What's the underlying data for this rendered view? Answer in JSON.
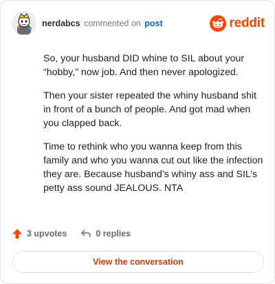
{
  "header": {
    "username": "nerdabcs",
    "action_text": "commented on",
    "post_link": "post",
    "brand_name": "reddit",
    "brand_color": "#ff4500",
    "avatar_icon": "snoo-avatar-icon"
  },
  "comment": {
    "paragraphs": [
      "So, your husband DID whine to SIL about your “hobby,” now job. And then never apologized.",
      "Then your sister repeated the whiny husband shit in front of a bunch of people. And got mad when you clapped back.",
      "Time to rethink who you wanna keep from this family and who you wanna cut out like the infection they are. Because husband’s whiny ass and SIL’s petty ass sound JEALOUS. NTA"
    ]
  },
  "actions": {
    "upvotes": "3 upvotes",
    "upvote_icon": "upvote-arrow-icon",
    "upvote_color": "#ff4500",
    "replies": "0 replies",
    "reply_icon": "reply-icon"
  },
  "cta": {
    "label": "View the conversation",
    "color": "#d93a00"
  }
}
